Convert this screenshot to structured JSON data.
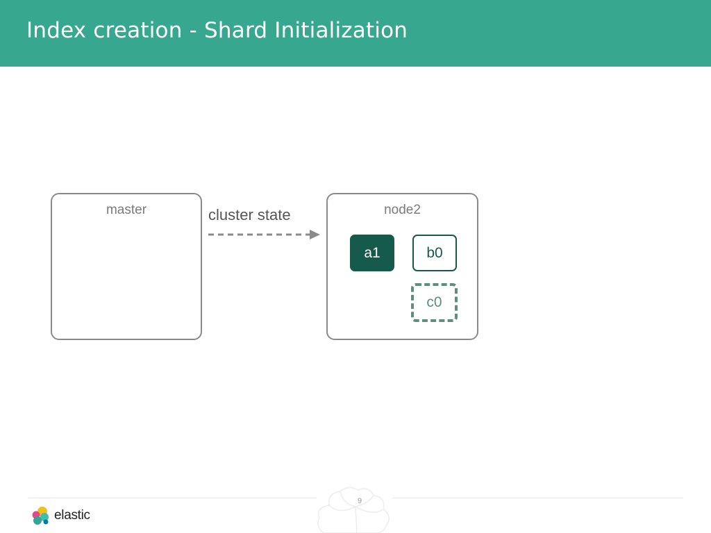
{
  "header": {
    "title": "Index creation - Shard Initialization",
    "background_color": "#37a88f"
  },
  "diagram": {
    "source_node": {
      "label": "master"
    },
    "arrow": {
      "label": "cluster state",
      "style": "dashed"
    },
    "target_node": {
      "label": "node2",
      "shards": [
        {
          "label": "a1",
          "state": "started",
          "color": "#155a4a"
        },
        {
          "label": "b0",
          "state": "started",
          "color": "#155a4a"
        },
        {
          "label": "c0",
          "state": "initializing",
          "color": "#5d8f7c"
        }
      ]
    }
  },
  "footer": {
    "page_number": "9",
    "logo": {
      "text": "elastic",
      "icon": "elastic-logo-icon"
    }
  }
}
